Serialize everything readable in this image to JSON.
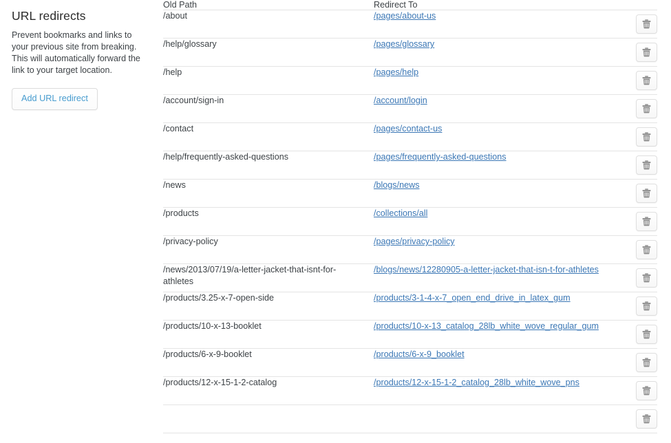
{
  "sidebar": {
    "title": "URL redirects",
    "description": "Prevent bookmarks and links to your previous site from breaking. This will automatically forward the link to your target location.",
    "add_button_label": "Add URL redirect"
  },
  "colors": {
    "link": "#3b77b5",
    "button_text": "#479ccf",
    "text": "#3d4246",
    "divider": "#e4e4e4",
    "background": "#ffffff"
  },
  "icons": {
    "delete": "trash-icon"
  },
  "table": {
    "columns": [
      {
        "key": "old_path",
        "label": "Old Path"
      },
      {
        "key": "redirect_to",
        "label": "Redirect To"
      },
      {
        "key": "actions",
        "label": ""
      }
    ],
    "rows": [
      {
        "old_path": "/about",
        "redirect_to": "/pages/about-us"
      },
      {
        "old_path": "/help/glossary",
        "redirect_to": "/pages/glossary"
      },
      {
        "old_path": "/help",
        "redirect_to": "/pages/help"
      },
      {
        "old_path": "/account/sign-in",
        "redirect_to": "/account/login"
      },
      {
        "old_path": "/contact",
        "redirect_to": "/pages/contact-us"
      },
      {
        "old_path": "/help/frequently-asked-questions",
        "redirect_to": "/pages/frequently-asked-questions"
      },
      {
        "old_path": "/news",
        "redirect_to": "/blogs/news"
      },
      {
        "old_path": "/products",
        "redirect_to": "/collections/all"
      },
      {
        "old_path": "/privacy-policy",
        "redirect_to": "/pages/privacy-policy"
      },
      {
        "old_path": "/news/2013/07/19/a-letter-jacket-that-isnt-for-athletes",
        "redirect_to": "/blogs/news/12280905-a-letter-jacket-that-isn-t-for-athletes"
      },
      {
        "old_path": "/products/3.25-x-7-open-side",
        "redirect_to": "/products/3-1-4-x-7_open_end_drive_in_latex_gum"
      },
      {
        "old_path": "/products/10-x-13-booklet",
        "redirect_to": "/products/10-x-13_catalog_28lb_white_wove_regular_gum"
      },
      {
        "old_path": "/products/6-x-9-booklet",
        "redirect_to": "/products/6-x-9_booklet"
      },
      {
        "old_path": "/products/12-x-15-1-2-catalog",
        "redirect_to": "/products/12-x-15-1-2_catalog_28lb_white_wove_pns"
      }
    ],
    "delete_button_label": "Delete redirect"
  }
}
